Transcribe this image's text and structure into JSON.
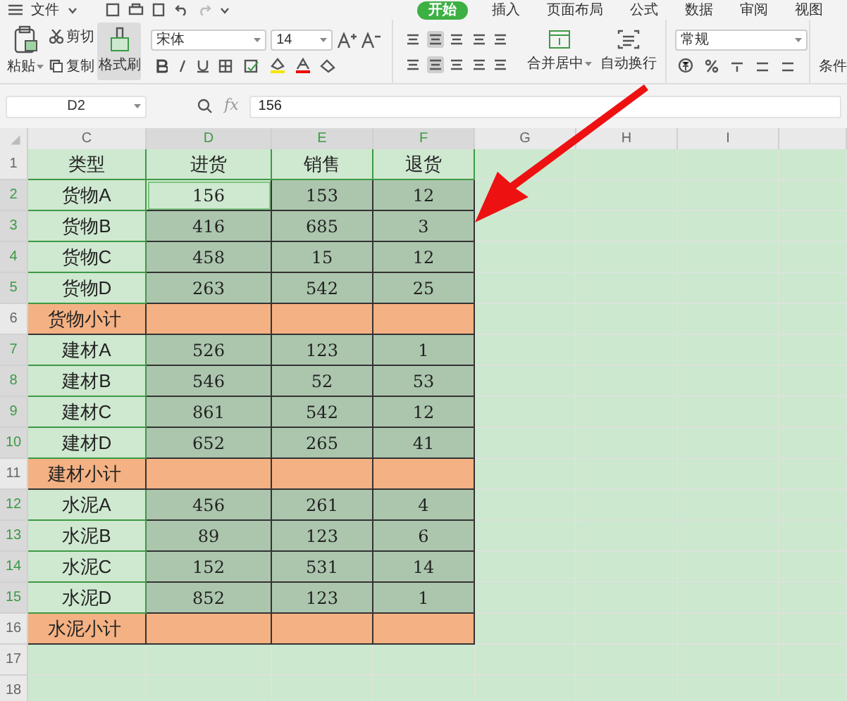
{
  "menu": {
    "file": "文件",
    "tabs": [
      {
        "label": "开始",
        "selected": true
      },
      {
        "label": "插入",
        "selected": false
      },
      {
        "label": "页面布局",
        "selected": false
      },
      {
        "label": "公式",
        "selected": false
      },
      {
        "label": "数据",
        "selected": false
      },
      {
        "label": "审阅",
        "selected": false
      },
      {
        "label": "视图",
        "selected": false
      }
    ]
  },
  "ribbon": {
    "paste": "粘贴",
    "cut": "剪切",
    "copy": "复制",
    "format_painter": {
      "label": "格式刷",
      "selected": true
    },
    "font_name": "宋体",
    "font_size": "14",
    "merge": "合并居中",
    "wrap": "自动换行",
    "number_format": "常规",
    "conditional": "条件"
  },
  "formula_bar": {
    "cell_ref": "D2",
    "fx": "fx",
    "value": "156"
  },
  "columns": [
    {
      "label": "C",
      "highlighted": false
    },
    {
      "label": "D",
      "highlighted": true
    },
    {
      "label": "E",
      "highlighted": true
    },
    {
      "label": "F",
      "highlighted": true
    },
    {
      "label": "G",
      "highlighted": false
    },
    {
      "label": "H",
      "highlighted": false
    },
    {
      "label": "I",
      "highlighted": false
    }
  ],
  "rows": [
    {
      "num": "1",
      "kind": "header",
      "highlighted": false,
      "cells": [
        "类型",
        "进货",
        "销售",
        "退货"
      ]
    },
    {
      "num": "2",
      "kind": "item",
      "highlighted": true,
      "cells": [
        "货物A",
        "156",
        "153",
        "12"
      ],
      "selected_cells": [
        false,
        true,
        false,
        false
      ]
    },
    {
      "num": "3",
      "kind": "item",
      "highlighted": true,
      "cells": [
        "货物B",
        "416",
        "685",
        "3"
      ]
    },
    {
      "num": "4",
      "kind": "item",
      "highlighted": true,
      "cells": [
        "货物C",
        "458",
        "15",
        "12"
      ]
    },
    {
      "num": "5",
      "kind": "item",
      "highlighted": true,
      "cells": [
        "货物D",
        "263",
        "542",
        "25"
      ]
    },
    {
      "num": "6",
      "kind": "subtotal",
      "highlighted": false,
      "cells": [
        "货物小计"
      ]
    },
    {
      "num": "7",
      "kind": "item",
      "highlighted": true,
      "cells": [
        "建材A",
        "526",
        "123",
        "1"
      ]
    },
    {
      "num": "8",
      "kind": "item",
      "highlighted": true,
      "cells": [
        "建材B",
        "546",
        "52",
        "53"
      ]
    },
    {
      "num": "9",
      "kind": "item",
      "highlighted": true,
      "cells": [
        "建材C",
        "861",
        "542",
        "12"
      ]
    },
    {
      "num": "10",
      "kind": "item",
      "highlighted": true,
      "cells": [
        "建材D",
        "652",
        "265",
        "41"
      ]
    },
    {
      "num": "11",
      "kind": "subtotal",
      "highlighted": false,
      "cells": [
        "建材小计"
      ]
    },
    {
      "num": "12",
      "kind": "item",
      "highlighted": true,
      "cells": [
        "水泥A",
        "456",
        "261",
        "4"
      ]
    },
    {
      "num": "13",
      "kind": "item",
      "highlighted": true,
      "cells": [
        "水泥B",
        "89",
        "123",
        "6"
      ]
    },
    {
      "num": "14",
      "kind": "item",
      "highlighted": true,
      "cells": [
        "水泥C",
        "152",
        "531",
        "14"
      ]
    },
    {
      "num": "15",
      "kind": "item",
      "highlighted": true,
      "cells": [
        "水泥D",
        "852",
        "123",
        "1"
      ]
    },
    {
      "num": "16",
      "kind": "subtotal",
      "highlighted": false,
      "cells": [
        "水泥小计"
      ]
    },
    {
      "num": "17",
      "kind": "empty",
      "highlighted": false,
      "cells": []
    },
    {
      "num": "18",
      "kind": "empty",
      "highlighted": false,
      "cells": []
    }
  ]
}
